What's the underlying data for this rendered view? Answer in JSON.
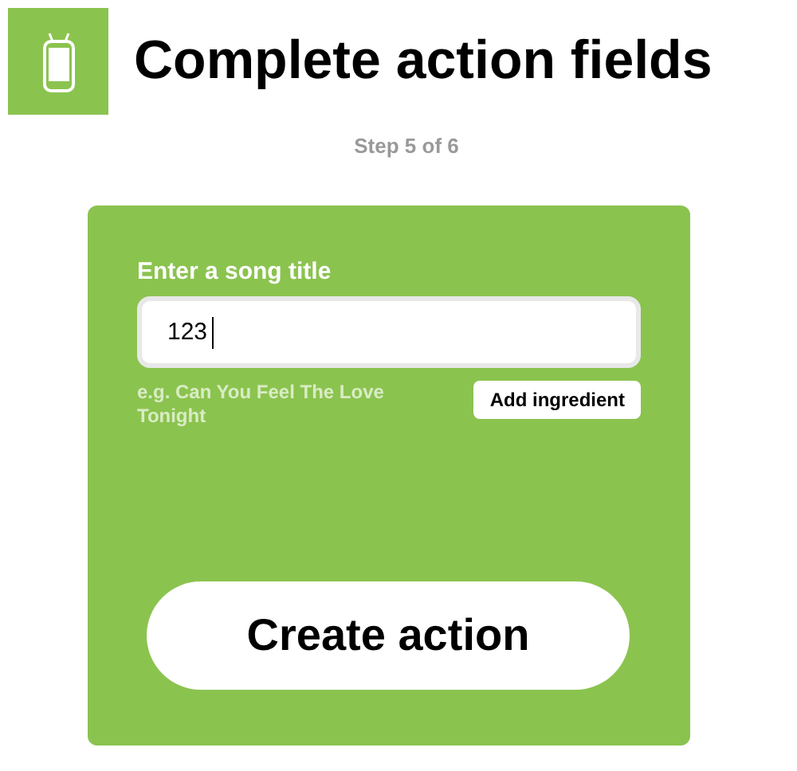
{
  "header": {
    "title": "Complete action fields",
    "step": "Step 5 of 6"
  },
  "form": {
    "label": "Enter a song title",
    "value": "123",
    "hint": "e.g. Can You Feel The Love Tonight",
    "ingredient_button": "Add ingredient",
    "submit_button": "Create action"
  }
}
